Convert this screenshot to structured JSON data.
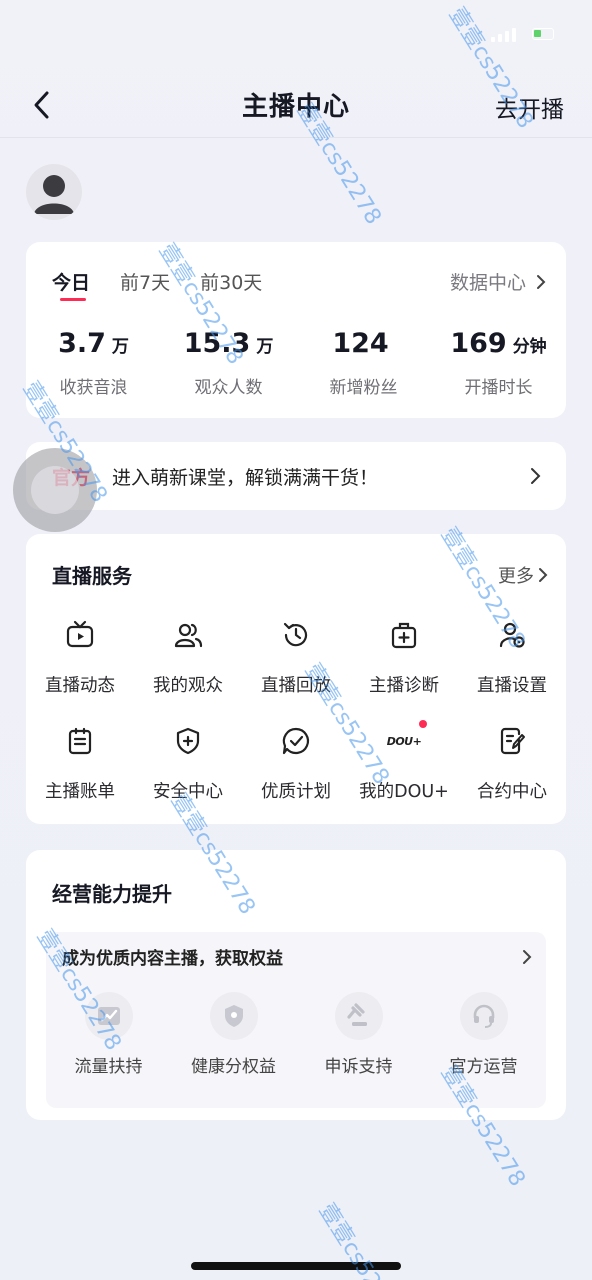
{
  "nav": {
    "title": "主播中心",
    "go_live": "去开播"
  },
  "stats": {
    "tabs": [
      "今日",
      "前7天",
      "前30天"
    ],
    "active_tab": "今日",
    "data_center": "数据中心",
    "metrics": [
      {
        "value": "3.7",
        "unit": "万",
        "label": "收获音浪"
      },
      {
        "value": "15.3",
        "unit": "万",
        "label": "观众人数"
      },
      {
        "value": "124",
        "unit": "",
        "label": "新增粉丝"
      },
      {
        "value": "169",
        "unit": "分钟",
        "label": "开播时长"
      }
    ]
  },
  "banner": {
    "tag": "官方",
    "text": "进入萌新课堂，解锁满满干货！"
  },
  "services": {
    "title": "直播服务",
    "more": "更多",
    "items": [
      {
        "label": "直播动态",
        "icon": "tv-icon"
      },
      {
        "label": "我的观众",
        "icon": "users-icon"
      },
      {
        "label": "直播回放",
        "icon": "replay-icon"
      },
      {
        "label": "主播诊断",
        "icon": "medkit-icon"
      },
      {
        "label": "直播设置",
        "icon": "user-settings-icon"
      },
      {
        "label": "主播账单",
        "icon": "bill-icon"
      },
      {
        "label": "安全中心",
        "icon": "shield-icon"
      },
      {
        "label": "优质计划",
        "icon": "check-chat-icon"
      },
      {
        "label": "我的DOU+",
        "icon": "dou-icon",
        "logo_text": "DOU+"
      },
      {
        "label": "合约中心",
        "icon": "contract-icon"
      }
    ]
  },
  "ability": {
    "title": "经营能力提升",
    "subtitle": "成为优质内容主播，获取权益",
    "perks": [
      {
        "label": "流量扶持",
        "icon": "traffic-icon"
      },
      {
        "label": "健康分权益",
        "icon": "health-shield-icon"
      },
      {
        "label": "申诉支持",
        "icon": "gavel-icon"
      },
      {
        "label": "官方运营",
        "icon": "headset-icon"
      }
    ]
  },
  "watermark": "壹壹cs52278",
  "colors": {
    "accent": "#fe2c55",
    "text": "#161823",
    "muted": "#6f6f75"
  }
}
